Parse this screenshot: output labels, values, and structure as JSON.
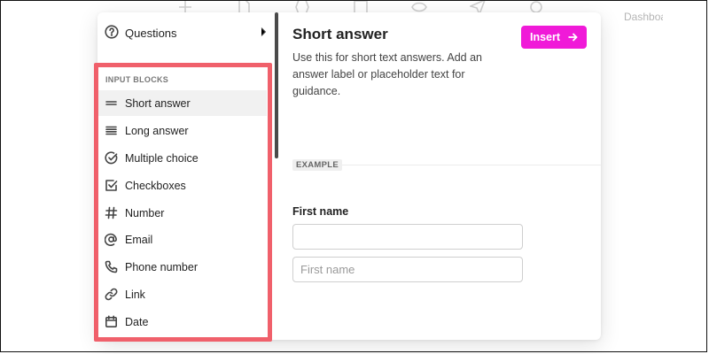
{
  "background": {
    "dashboard_label": "Dashboa"
  },
  "sidebar": {
    "questions_label": "Questions",
    "section_title": "INPUT BLOCKS",
    "items": [
      {
        "label": "Short answer",
        "icon": "short-answer-icon",
        "active": true
      },
      {
        "label": "Long answer",
        "icon": "long-answer-icon"
      },
      {
        "label": "Multiple choice",
        "icon": "multiple-choice-icon"
      },
      {
        "label": "Checkboxes",
        "icon": "checkbox-icon"
      },
      {
        "label": "Number",
        "icon": "hash-icon"
      },
      {
        "label": "Email",
        "icon": "at-icon"
      },
      {
        "label": "Phone number",
        "icon": "phone-icon"
      },
      {
        "label": "Link",
        "icon": "link-icon"
      },
      {
        "label": "Date",
        "icon": "calendar-icon"
      }
    ]
  },
  "detail": {
    "title": "Short answer",
    "description": "Use this for short text answers. Add an answer label or placeholder text for guidance.",
    "insert_label": "Insert",
    "example_badge": "EXAMPLE",
    "field_label": "First name",
    "input_value": "",
    "input_placeholder": "First name"
  },
  "colors": {
    "accent": "#f01ad8",
    "highlight": "#f0606b"
  }
}
